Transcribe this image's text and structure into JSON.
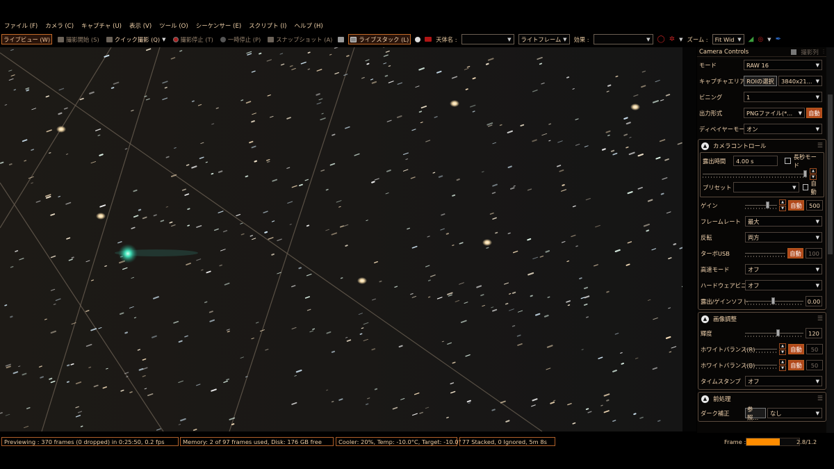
{
  "menu": [
    "ファイル (F)",
    "カメラ (C)",
    "キャプチャ (U)",
    "表示 (V)",
    "ツール (O)",
    "シーケンサー (E)",
    "スクリプト (I)",
    "ヘルプ (H)"
  ],
  "toolbar": {
    "live_view": "ライブビュー (W)",
    "start_capture": "撮影開始 (S)",
    "quick_capture": "クイック撮影 (Q)",
    "stop_capture": "撮影停止 (T)",
    "pause": "一時停止 (P)",
    "snapshot": "スナップショット (A)",
    "live_stack": "ライブスタック (L)",
    "object_label": "天体名 :",
    "object_value": "",
    "frame_type": "ライトフレーム",
    "effect_label": "効果 :",
    "effect_value": "",
    "zoom_label": "ズーム :",
    "zoom_value": "Fit Wid"
  },
  "panel": {
    "header": "Camera Controls",
    "header_right": "撮影列",
    "mode_label": "モード",
    "mode_value": "RAW 16",
    "capture_area_label": "キャプチャエリア",
    "roi_button": "ROIの選択",
    "resolution": "3840x21...",
    "binning_label": "ビニング",
    "binning_value": "1",
    "output_label": "出力形式",
    "output_value": "PNGファイル(*...",
    "auto": "自動",
    "debayer_label": "ディベイヤーモード",
    "debayer_value": "オン"
  },
  "camera_control": {
    "title": "カメラコントロール",
    "exposure_label": "露出時間",
    "exposure_value": "4.00 s",
    "long_exposure": "長秒モード",
    "preset_label": "プリセット",
    "preset_value": "",
    "auto": "自動",
    "gain_label": "ゲイン",
    "gain_value": "500",
    "framerate_label": "フレームレート",
    "framerate_value": "最大",
    "flip_label": "反転",
    "flip_value": "両方",
    "turbo_label": "ターボUSB",
    "turbo_value": "100",
    "highspeed_label": "高速モード",
    "highspeed_value": "オフ",
    "hwbin_label": "ハードウェアビニング",
    "hwbin_value": "オフ",
    "exp_gain_soft_label": "露出/ゲインソフト",
    "exp_gain_soft_value": "0.00"
  },
  "image_adjust": {
    "title": "画像調整",
    "brightness_label": "輝度",
    "brightness_value": "120",
    "wb_r_label": "ホワイトバランス(R)",
    "wb_r_value": "50",
    "wb_b_label": "ホワイトバランス(B)",
    "wb_b_value": "50",
    "auto": "自動",
    "timestamp_label": "タイムスタンプ",
    "timestamp_value": "オフ"
  },
  "preprocess": {
    "title": "前処理",
    "dark_label": "ダーク補正",
    "browse": "参照...",
    "dark_value": "なし"
  },
  "status": {
    "preview": "Previewing : 370 frames (0 dropped) in 0:25:50, 0.2 fps",
    "memory": "Memory: 2 of 97 frames used, Disk: 176 GB free",
    "cooler": "Cooler: 20%, Temp: -10.0°C, Target: -10.0°",
    "stack": "77 Stacked, 0 Ignored, 5m 8s",
    "frame_label": "Frame :",
    "frame_progress": 0.63,
    "ratio": "2.8/1.2"
  },
  "colors": {
    "accent": "#ff8c00",
    "button_active": "#b1481a",
    "comet": "#3fe0b8"
  },
  "icons": [
    "camera-icon",
    "record-icon",
    "pause-icon",
    "snapshot-icon",
    "stack-icon",
    "target-icon",
    "crosshair-icon",
    "histogram-icon",
    "pin-icon",
    "chevron-up-icon",
    "menu-icon"
  ]
}
